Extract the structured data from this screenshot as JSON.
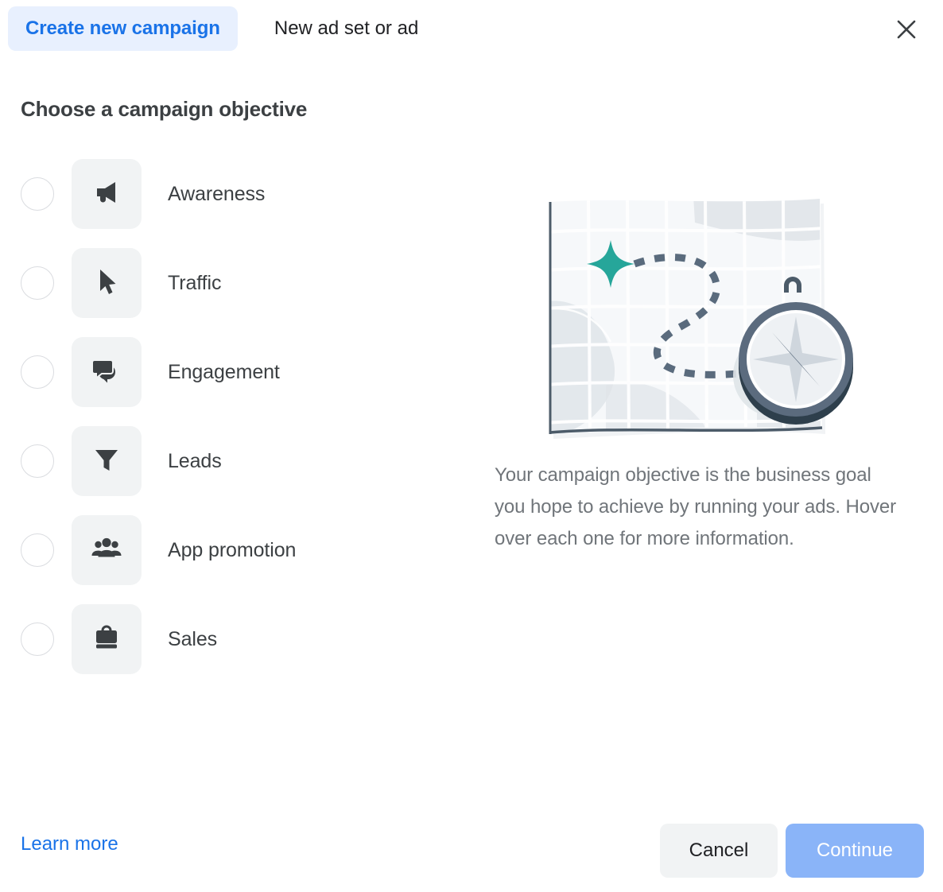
{
  "header": {
    "tab_create_campaign": "Create new campaign",
    "tab_new_adset": "New ad set or ad",
    "close_icon": "close-icon"
  },
  "main": {
    "title": "Choose a campaign objective",
    "objectives": [
      {
        "label": "Awareness",
        "icon": "megaphone-icon",
        "selected": false
      },
      {
        "label": "Traffic",
        "icon": "cursor-icon",
        "selected": false
      },
      {
        "label": "Engagement",
        "icon": "chat-bubbles-icon",
        "selected": false
      },
      {
        "label": "Leads",
        "icon": "funnel-icon",
        "selected": false
      },
      {
        "label": "App promotion",
        "icon": "people-icon",
        "selected": false
      },
      {
        "label": "Sales",
        "icon": "briefcase-icon",
        "selected": false
      }
    ]
  },
  "info_panel": {
    "illustration": "map-with-compass-illustration",
    "description": "Your campaign objective is the business goal you hope to achieve by running your ads. Hover over each one for more information."
  },
  "footer": {
    "learn_more": "Learn more",
    "cancel": "Cancel",
    "continue": "Continue"
  },
  "colors": {
    "accent_blue": "#1a73e8",
    "tab_pill_bg": "#e8f0fe",
    "disabled_blue": "#8ab4f8",
    "neutral_bg": "#f1f3f4",
    "icon_dark": "#3c4043",
    "text_secondary": "#70757a",
    "illustration_teal": "#26a69a",
    "illustration_slate": "#5a6b7d"
  }
}
